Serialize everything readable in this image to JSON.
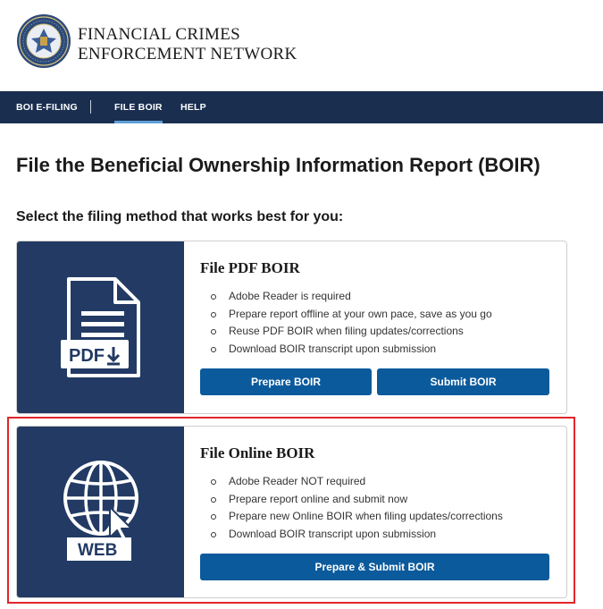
{
  "header": {
    "agency_line1": "FINANCIAL CRIMES",
    "agency_line2": "ENFORCEMENT NETWORK",
    "seal_icon": "treasury-seal-icon"
  },
  "nav": {
    "items": [
      {
        "label": "BOI E-FILING",
        "active": false
      },
      {
        "label": "FILE BOIR",
        "active": true
      },
      {
        "label": "HELP",
        "active": false
      }
    ]
  },
  "page": {
    "title": "File the Beneficial Ownership Information Report (BOIR)",
    "subtitle": "Select the filing method that works best for you:"
  },
  "pdf_card": {
    "title": "File PDF BOIR",
    "icon": "pdf-document-icon",
    "icon_label": "PDF",
    "bullets": [
      "Adobe Reader is required",
      "Prepare report offline at your own pace, save as you go",
      "Reuse PDF BOIR when filing updates/corrections",
      "Download BOIR transcript upon submission"
    ],
    "prepare_label": "Prepare BOIR",
    "submit_label": "Submit BOIR"
  },
  "web_card": {
    "title": "File Online BOIR",
    "icon": "web-globe-icon",
    "icon_label": "WEB",
    "bullets": [
      "Adobe Reader NOT required",
      "Prepare report online and submit now",
      "Prepare new Online BOIR when filing updates/corrections",
      "Download BOIR transcript upon submission"
    ],
    "prepare_submit_label": "Prepare & Submit BOIR"
  },
  "colors": {
    "nav_bg": "#1a2e4f",
    "card_icon_bg": "#223a64",
    "button_bg": "#0b5a9c",
    "highlight": "#e1252a"
  }
}
